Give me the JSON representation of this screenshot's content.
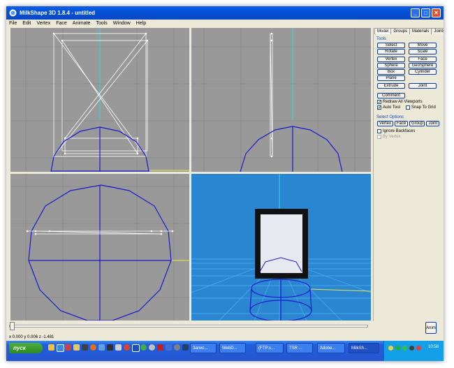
{
  "window": {
    "title": "MilkShape 3D 1.8.4 - untitled",
    "minimize": "_",
    "maximize": "□",
    "close": "✕"
  },
  "menu": [
    "File",
    "Edit",
    "Vertex",
    "Face",
    "Animate",
    "Tools",
    "Window",
    "Help"
  ],
  "panel": {
    "tabs": [
      "Model",
      "Groups",
      "Materials",
      "Joints"
    ],
    "active_tab": "Model",
    "tools_title": "Tools",
    "tool_buttons": [
      [
        "Select",
        "Move"
      ],
      [
        "Rotate",
        "Scale"
      ],
      [
        "Vertex",
        "Face"
      ],
      [
        "Sphere",
        "GeoSphere"
      ],
      [
        "Box",
        "Cylinder"
      ],
      [
        "Plane",
        ""
      ],
      [
        "Extrude",
        "Joint"
      ]
    ],
    "comment_button": "Comment",
    "redraw_all_viewports": {
      "label": "Redraw All Viewports",
      "checked": true
    },
    "auto_tool": {
      "label": "Auto Tool",
      "checked": true
    },
    "snap_to_grid": {
      "label": "Snap To Grid",
      "checked": false
    },
    "select_options_title": "Select Options",
    "select_buttons": [
      "Vertex",
      "Face",
      "Group",
      "Joint"
    ],
    "ignore_backfaces": {
      "label": "Ignore Backfaces",
      "checked": false
    },
    "by_vertex": {
      "label": "By Vertex",
      "checked": false
    }
  },
  "animation": {
    "anim_button": "Anim",
    "frame_position": 0.0
  },
  "status": {
    "coordinates": "x 0.000 y 0.006 z -1.481"
  },
  "taskbar": {
    "start_label": "пуск",
    "tasks": [
      {
        "label": "Запис..."
      },
      {
        "label": "WebD..."
      },
      {
        "label": "(FTP:s..."
      },
      {
        "label": "TSR ..."
      },
      {
        "label": "Adobe..."
      },
      {
        "label": "MilkSh..."
      }
    ],
    "active_task": "MilkSh...",
    "clock": "10:58"
  },
  "colors": {
    "titlebar": "#0450d6",
    "viewport_gray": "#999999",
    "viewport_3d": "#2b86d1",
    "mesh_blue": "#1a1acc",
    "wire_white": "#ffffff",
    "axis_cyan": "#33d6e6",
    "axis_yellow": "#e6e64d",
    "button_border": "#0a3b9f"
  }
}
